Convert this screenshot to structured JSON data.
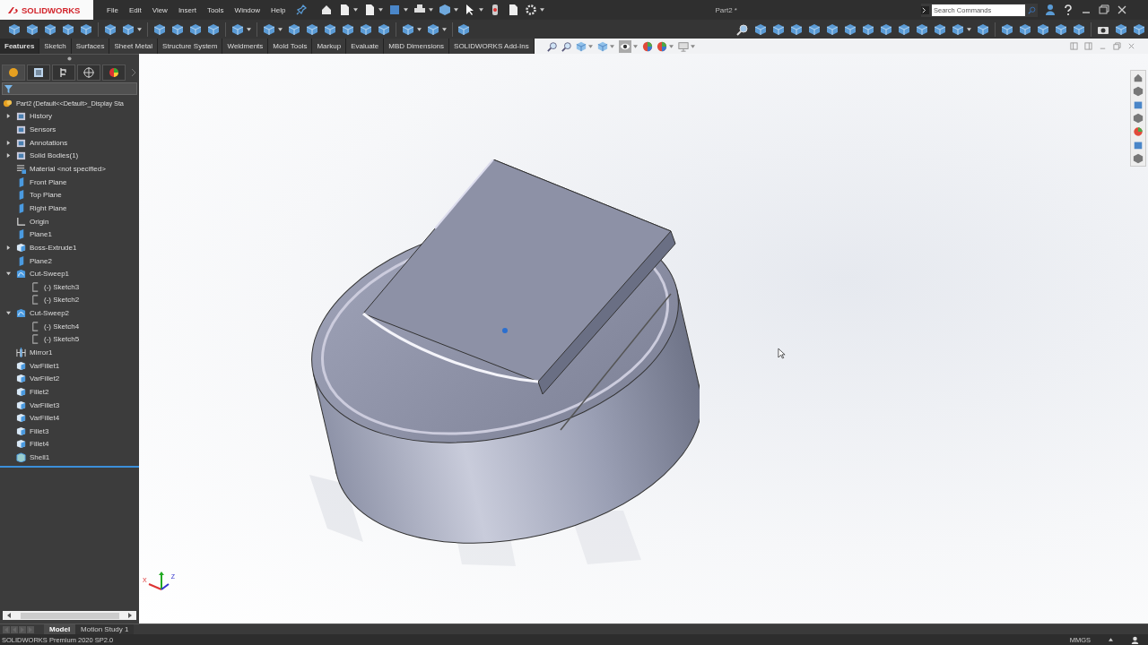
{
  "app": {
    "logo": "SOLIDWORKS",
    "menu": [
      "File",
      "Edit",
      "View",
      "Insert",
      "Tools",
      "Window",
      "Help"
    ],
    "document_title": "Part2 *",
    "search": {
      "placeholder": "Search Commands"
    }
  },
  "command_tabs": [
    {
      "label": "Features",
      "selected": true
    },
    {
      "label": "Sketch",
      "selected": false
    },
    {
      "label": "Surfaces",
      "selected": false
    },
    {
      "label": "Sheet Metal",
      "selected": false
    },
    {
      "label": "Structure System",
      "selected": false
    },
    {
      "label": "Weldments",
      "selected": false
    },
    {
      "label": "Mold Tools",
      "selected": false
    },
    {
      "label": "Markup",
      "selected": false
    },
    {
      "label": "Evaluate",
      "selected": false
    },
    {
      "label": "MBD Dimensions",
      "selected": false
    },
    {
      "label": "SOLIDWORKS Add-Ins",
      "selected": false
    }
  ],
  "feature_tree": {
    "root": "Part2  (Default<<Default>_Display Sta",
    "items": [
      {
        "label": "History",
        "kind": "history",
        "expanded": false
      },
      {
        "label": "Sensors",
        "kind": "sensors"
      },
      {
        "label": "Annotations",
        "kind": "annotations",
        "expanded": false
      },
      {
        "label": "Solid Bodies(1)",
        "kind": "bodies",
        "expanded": false
      },
      {
        "label": "Material <not specified>",
        "kind": "material"
      },
      {
        "label": "Front Plane",
        "kind": "plane"
      },
      {
        "label": "Top Plane",
        "kind": "plane"
      },
      {
        "label": "Right Plane",
        "kind": "plane"
      },
      {
        "label": "Origin",
        "kind": "origin"
      },
      {
        "label": "Plane1",
        "kind": "plane"
      },
      {
        "label": "Boss-Extrude1",
        "kind": "extrude",
        "expanded": false
      },
      {
        "label": "Plane2",
        "kind": "plane"
      },
      {
        "label": "Cut-Sweep1",
        "kind": "sweep",
        "expanded": true,
        "children": [
          {
            "label": "(-) Sketch3",
            "kind": "sketch"
          },
          {
            "label": "(-) Sketch2",
            "kind": "sketch"
          }
        ]
      },
      {
        "label": "Cut-Sweep2",
        "kind": "sweep",
        "expanded": true,
        "children": [
          {
            "label": "(-) Sketch4",
            "kind": "sketch"
          },
          {
            "label": "(-) Sketch5",
            "kind": "sketch"
          }
        ]
      },
      {
        "label": "Mirror1",
        "kind": "mirror"
      },
      {
        "label": "VarFillet1",
        "kind": "fillet"
      },
      {
        "label": "VarFillet2",
        "kind": "fillet"
      },
      {
        "label": "Fillet2",
        "kind": "fillet"
      },
      {
        "label": "VarFillet3",
        "kind": "fillet"
      },
      {
        "label": "VarFillet4",
        "kind": "fillet"
      },
      {
        "label": "Fillet3",
        "kind": "fillet"
      },
      {
        "label": "Fillet4",
        "kind": "fillet"
      },
      {
        "label": "Shell1",
        "kind": "shell"
      }
    ]
  },
  "triad": {
    "x_label": "X",
    "z_label": "Z"
  },
  "bottom_tabs": [
    {
      "label": "Model",
      "selected": true
    },
    {
      "label": "Motion Study 1",
      "selected": false
    }
  ],
  "status_bar": {
    "product": "SOLIDWORKS Premium 2020 SP2.0",
    "units": "MMGS"
  }
}
